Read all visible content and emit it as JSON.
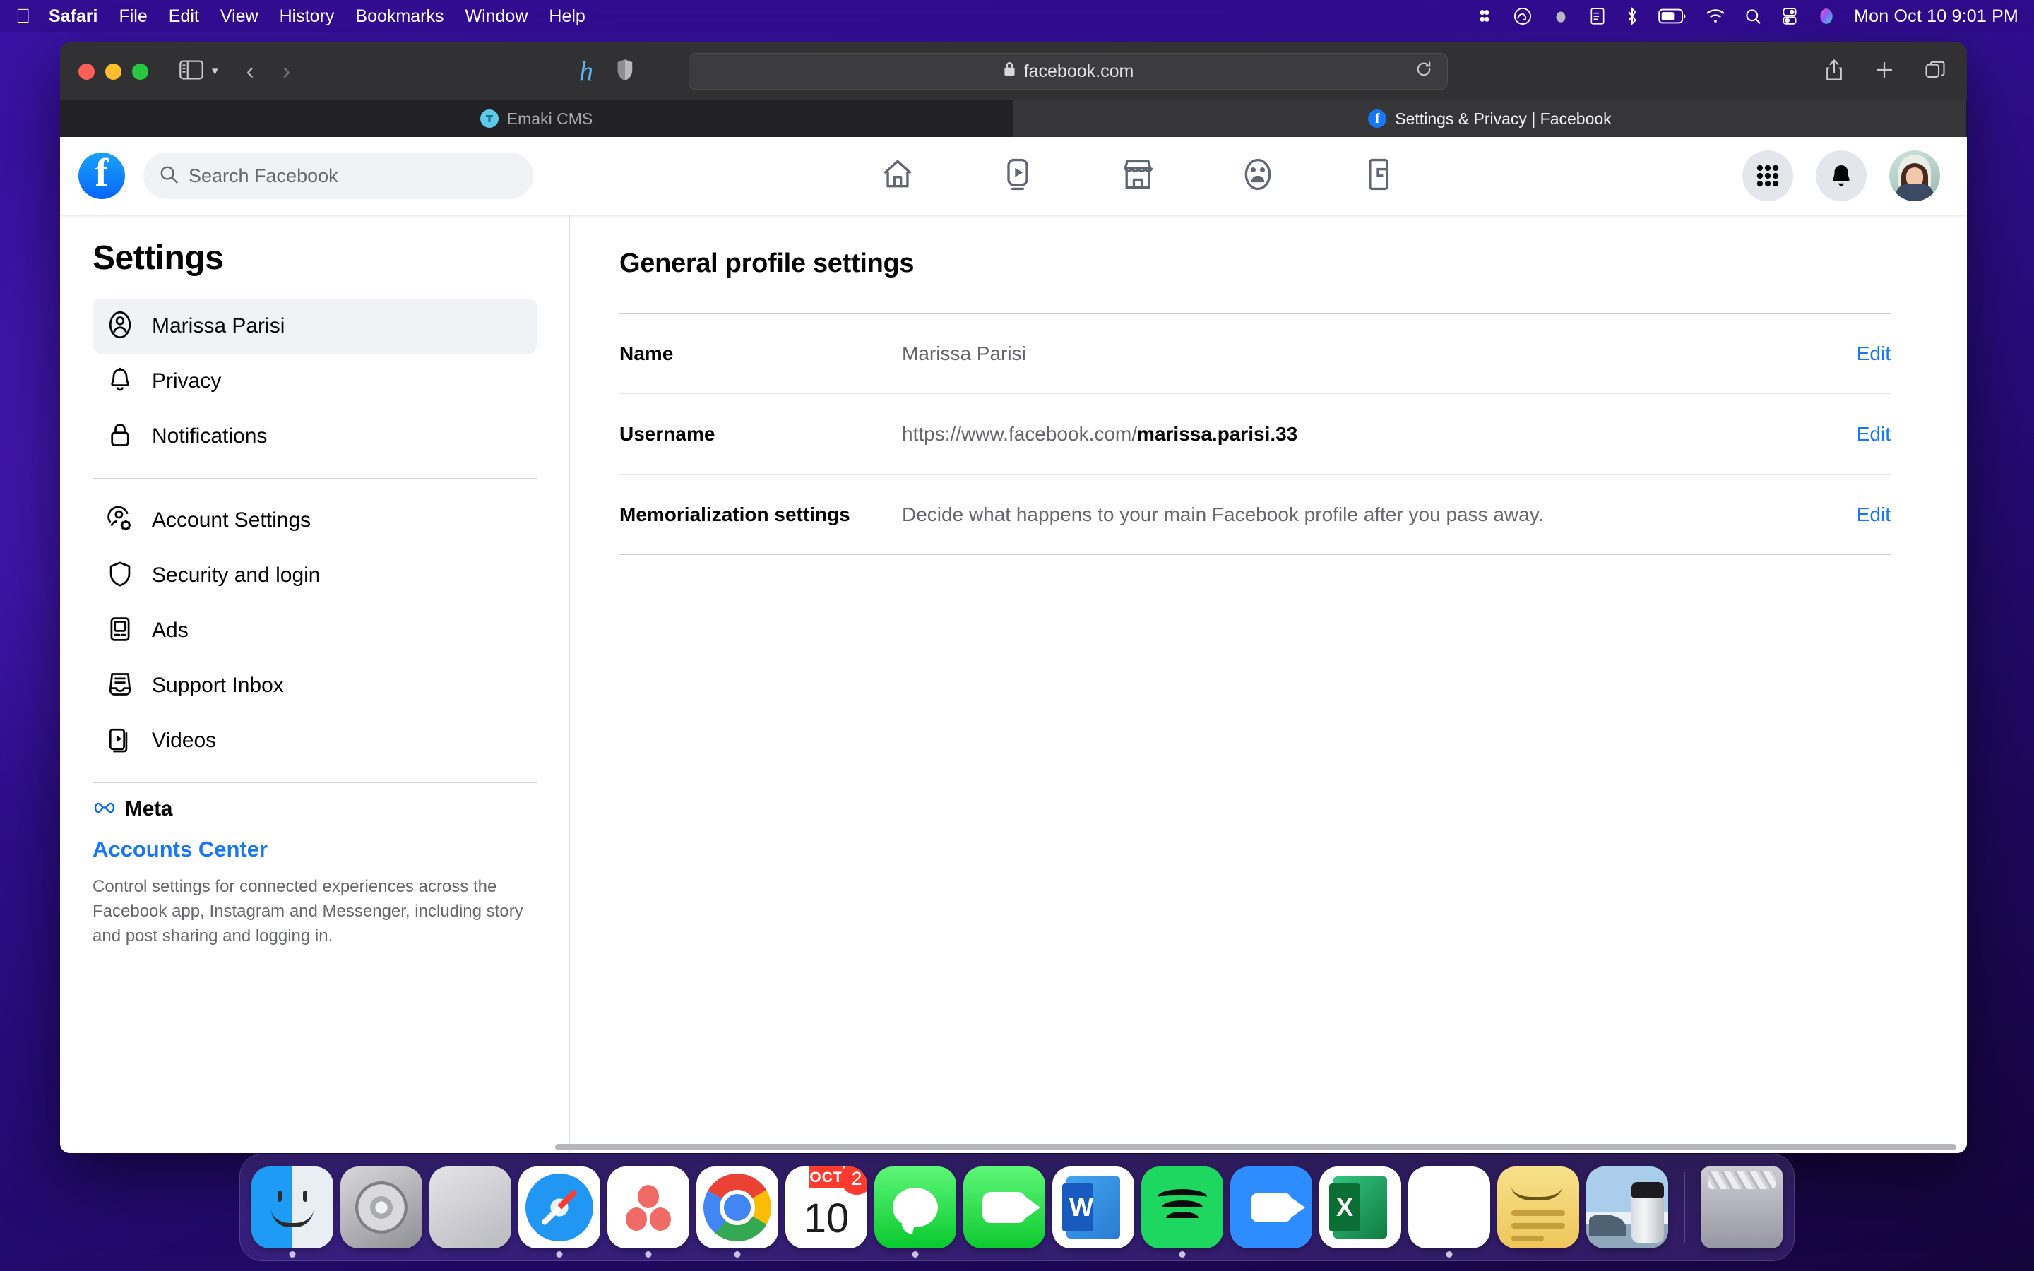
{
  "menubar": {
    "apple_icon": "apple-icon",
    "items": [
      "Safari",
      "File",
      "Edit",
      "View",
      "History",
      "Bookmarks",
      "Window",
      "Help"
    ],
    "status_icons": [
      "dropbox-icon",
      "adobe-creative-cloud-icon",
      "cloud-icon",
      "notes-menu-icon",
      "bluetooth-icon",
      "battery-icon",
      "wifi-icon",
      "spotlight-search-icon",
      "control-center-icon",
      "siri-icon"
    ],
    "clock": "Mon Oct 10  9:01 PM"
  },
  "browser": {
    "window_controls": [
      "close",
      "minimize",
      "maximize"
    ],
    "sidebar_toggle": "sidebar-icon",
    "back_label": "‹",
    "forward_label": "›",
    "extensions": [
      "honey-extension-icon",
      "shield-privacy-icon"
    ],
    "url": "facebook.com",
    "lock_icon": "lock-icon",
    "reload_icon": "reload-icon",
    "right_icons": [
      "share-icon",
      "new-tab-icon",
      "tab-overview-icon"
    ],
    "tabs": [
      {
        "title": "Emaki CMS",
        "favicon": "emaki-favicon",
        "active": false
      },
      {
        "title": "Settings & Privacy | Facebook",
        "favicon": "facebook-favicon",
        "active": true
      }
    ]
  },
  "facebook_header": {
    "logo": "facebook-logo",
    "search_placeholder": "Search Facebook",
    "search_icon": "search-icon",
    "nav_icons": [
      "home-icon",
      "watch-video-icon",
      "marketplace-icon",
      "groups-icon",
      "gaming-icon"
    ],
    "right_icons": [
      "menu-grid-icon",
      "notifications-bell-icon"
    ],
    "avatar": "profile-avatar"
  },
  "sidebar": {
    "title": "Settings",
    "items": [
      {
        "label": "Marissa Parisi",
        "icon": "person-circle-icon",
        "active": true
      },
      {
        "label": "Privacy",
        "icon": "bell-icon",
        "active": false
      },
      {
        "label": "Notifications",
        "icon": "lock-icon",
        "active": false
      }
    ],
    "items2": [
      {
        "label": "Account Settings",
        "icon": "account-gear-icon"
      },
      {
        "label": "Security and login",
        "icon": "shield-icon"
      },
      {
        "label": "Ads",
        "icon": "ad-screen-icon"
      },
      {
        "label": "Support Inbox",
        "icon": "inbox-icon"
      },
      {
        "label": "Videos",
        "icon": "video-icon"
      }
    ],
    "meta": {
      "brand": "Meta",
      "brand_icon": "meta-infinity-icon",
      "link": "Accounts Center",
      "description": "Control settings for connected experiences across the Facebook app, Instagram and Messenger, including story and post sharing and logging in."
    }
  },
  "main": {
    "heading": "General profile settings",
    "edit_label": "Edit",
    "rows": [
      {
        "label": "Name",
        "value": "Marissa Parisi",
        "value_bold": "",
        "action": "Edit"
      },
      {
        "label": "Username",
        "value": "https://www.facebook.com/",
        "value_bold": "marissa.parisi.33",
        "action": "Edit"
      },
      {
        "label": "Memorialization settings",
        "value": "Decide what happens to your main Facebook profile after you pass away.",
        "value_bold": "",
        "action": "Edit"
      }
    ]
  },
  "dock": {
    "items": [
      {
        "name": "Finder",
        "icon": "finder-icon",
        "running": true,
        "badge": ""
      },
      {
        "name": "System Preferences",
        "icon": "system-preferences-icon",
        "running": false,
        "badge": ""
      },
      {
        "name": "Launchpad",
        "icon": "launchpad-icon",
        "running": false,
        "badge": ""
      },
      {
        "name": "Safari",
        "icon": "safari-icon",
        "running": true,
        "badge": ""
      },
      {
        "name": "Bumble",
        "icon": "bumble-icon",
        "running": true,
        "badge": ""
      },
      {
        "name": "Google Chrome",
        "icon": "chrome-icon",
        "running": true,
        "badge": ""
      },
      {
        "name": "Calendar",
        "icon": "calendar-icon",
        "running": false,
        "badge": "2",
        "month": "OCT",
        "day": "10"
      },
      {
        "name": "Messages",
        "icon": "messages-icon",
        "running": true,
        "badge": ""
      },
      {
        "name": "FaceTime",
        "icon": "facetime-icon",
        "running": false,
        "badge": ""
      },
      {
        "name": "Microsoft Word",
        "icon": "word-icon",
        "running": false,
        "badge": ""
      },
      {
        "name": "Spotify",
        "icon": "spotify-icon",
        "running": true,
        "badge": ""
      },
      {
        "name": "Zoom",
        "icon": "zoom-icon",
        "running": false,
        "badge": ""
      },
      {
        "name": "Microsoft Excel",
        "icon": "excel-icon",
        "running": false,
        "badge": ""
      },
      {
        "name": "Slack",
        "icon": "slack-icon",
        "running": true,
        "badge": ""
      },
      {
        "name": "Stickies",
        "icon": "stickies-notes-icon",
        "running": true,
        "badge": ""
      },
      {
        "name": "Preview",
        "icon": "preview-icon",
        "running": false,
        "badge": ""
      }
    ],
    "trash": {
      "name": "Trash",
      "icon": "trash-icon"
    }
  }
}
